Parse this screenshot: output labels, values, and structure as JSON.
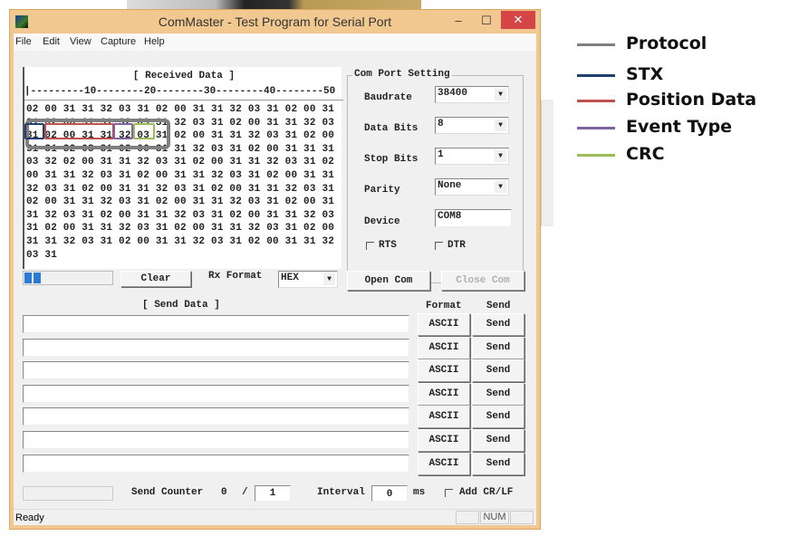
{
  "window": {
    "title": "ComMaster - Test Program for Serial Port",
    "minimize": "–",
    "maximize": "☐",
    "close": "✕"
  },
  "menu": [
    "File",
    "Edit",
    "View",
    "Capture",
    "Help"
  ],
  "received": {
    "title": "[ Received Data ]",
    "ruler": "|---------10--------20--------30--------40--------50",
    "rows": [
      "02 00 31 31 32 03 31 02 00 31 31 32 03 31 02 00 31",
      "31 02 00 31 31 32 03 31 32 03 31 02 00 31 31 32 03",
      "31 02 00 31 31 32 03 31 02 00 31 31 32 03 31 02 00",
      "31 31 32 03 31 02 00 31 31 32 03 31 02 00 31 31 31",
      "03 32 02 00 31 31 32 03 31 02 00 31 31 32 03 31 02",
      "00 31 31 32 03 31 02 00 31 31 32 03 31 02 00 31 31",
      "32 03 31 02 00 31 31 32 03 31 02 00 31 31 32 03 31",
      "02 00 31 31 32 03 31 02 00 31 31 32 03 31 02 00 31",
      "31 32 03 31 02 00 31 31 32 03 31 02 00 31 31 32 03",
      "31 02 00 31 31 32 03 31 02 00 31 31 32 03 31 02 00",
      "31 31 32 03 31 02 00 31 31 32 03 31 02 00 31 31 32",
      "03 31"
    ]
  },
  "port": {
    "legend": "Com Port Setting",
    "baudrate_label": "Baudrate",
    "baudrate": "38400",
    "databits_label": "Data Bits",
    "databits": "8",
    "stopbits_label": "Stop Bits",
    "stopbits": "1",
    "parity_label": "Parity",
    "parity": "None",
    "device_label": "Device",
    "device": "COM8",
    "rts_label": "RTS",
    "rts": false,
    "dtr_label": "DTR",
    "dtr": false
  },
  "controls": {
    "progress_percent": 20,
    "clear": "Clear",
    "rx_format_label": "Rx Format",
    "rx_format": "HEX",
    "open": "Open Com",
    "close": "Close Com"
  },
  "send": {
    "title": "[ Send Data ]",
    "format_header": "Format",
    "send_header": "Send",
    "rows": [
      {
        "value": "",
        "format": "ASCII",
        "send": "Send"
      },
      {
        "value": "",
        "format": "ASCII",
        "send": "Send"
      },
      {
        "value": "",
        "format": "ASCII",
        "send": "Send"
      },
      {
        "value": "",
        "format": "ASCII",
        "send": "Send"
      },
      {
        "value": "",
        "format": "ASCII",
        "send": "Send"
      },
      {
        "value": "",
        "format": "ASCII",
        "send": "Send"
      },
      {
        "value": "",
        "format": "ASCII",
        "send": "Send"
      }
    ],
    "counter_label": "Send Counter",
    "counter": "0",
    "slash": "/",
    "counter_total": "1",
    "interval_label": "Interval",
    "interval": "0",
    "ms": "ms",
    "crlf_label": "Add CR/LF",
    "crlf": false
  },
  "status": {
    "text": "Ready",
    "num": "NUM"
  },
  "legend": [
    {
      "label": "Protocol",
      "color": "#7f7f7f"
    },
    {
      "label": "STX",
      "color": "#1f3f6e"
    },
    {
      "label": "Position Data",
      "color": "#c0504d"
    },
    {
      "label": "Event Type",
      "color": "#8064a2"
    },
    {
      "label": "CRC",
      "color": "#9bbb59"
    }
  ]
}
